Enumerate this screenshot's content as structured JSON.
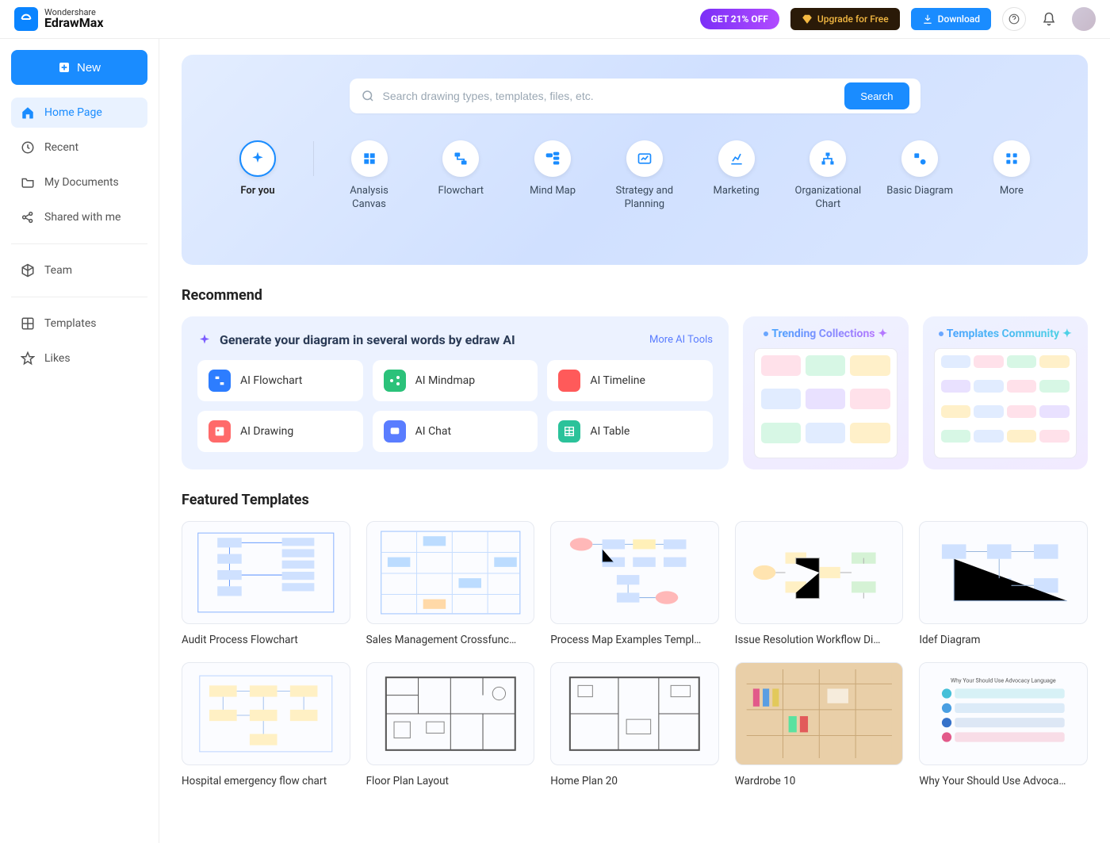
{
  "brand": {
    "sub": "Wondershare",
    "main": "EdrawMax"
  },
  "header": {
    "promo": "GET 21% OFF",
    "upgrade": "Upgrade for Free",
    "download": "Download"
  },
  "sidebar": {
    "new_label": "New",
    "items": [
      {
        "label": "Home Page",
        "icon": "home",
        "active": true
      },
      {
        "label": "Recent",
        "icon": "clock"
      },
      {
        "label": "My Documents",
        "icon": "folder"
      },
      {
        "label": "Shared with me",
        "icon": "share"
      }
    ],
    "group2": [
      {
        "label": "Team",
        "icon": "cube"
      }
    ],
    "group3": [
      {
        "label": "Templates",
        "icon": "grid"
      },
      {
        "label": "Likes",
        "icon": "star"
      }
    ]
  },
  "search": {
    "placeholder": "Search drawing types, templates, files, etc.",
    "button": "Search"
  },
  "categories": [
    {
      "label": "For you",
      "active": true
    },
    {
      "label": "Analysis Canvas"
    },
    {
      "label": "Flowchart"
    },
    {
      "label": "Mind Map"
    },
    {
      "label": "Strategy and Planning"
    },
    {
      "label": "Marketing"
    },
    {
      "label": "Organizational Chart"
    },
    {
      "label": "Basic Diagram"
    },
    {
      "label": "More"
    }
  ],
  "recommend": {
    "heading": "Recommend",
    "ai_title": "Generate your diagram in several words by edraw AI",
    "more": "More AI Tools",
    "tools": [
      {
        "label": "AI Flowchart",
        "color": "#2d7dff"
      },
      {
        "label": "AI Mindmap",
        "color": "#2bc27a"
      },
      {
        "label": "AI Timeline",
        "color": "#ff5a5a"
      },
      {
        "label": "AI Drawing",
        "color": "#ff6a6a"
      },
      {
        "label": "AI Chat",
        "color": "#5a7dff"
      },
      {
        "label": "AI Table",
        "color": "#2bc29a"
      }
    ],
    "trending": "Trending Collections",
    "community": "Templates Community"
  },
  "featured": {
    "heading": "Featured Templates",
    "items": [
      "Audit Process Flowchart",
      "Sales Management Crossfunc…",
      "Process Map Examples Templ…",
      "Issue Resolution Workflow Di…",
      "Idef Diagram",
      "Hospital emergency flow chart",
      "Floor Plan Layout",
      "Home Plan 20",
      "Wardrobe 10",
      "Why Your Should Use Advoca…"
    ]
  },
  "colors": {
    "primary": "#1a8cff",
    "promo_bg": "#8b3cff",
    "upgrade_bg": "#2a1a08",
    "upgrade_fg": "#f4b942"
  }
}
